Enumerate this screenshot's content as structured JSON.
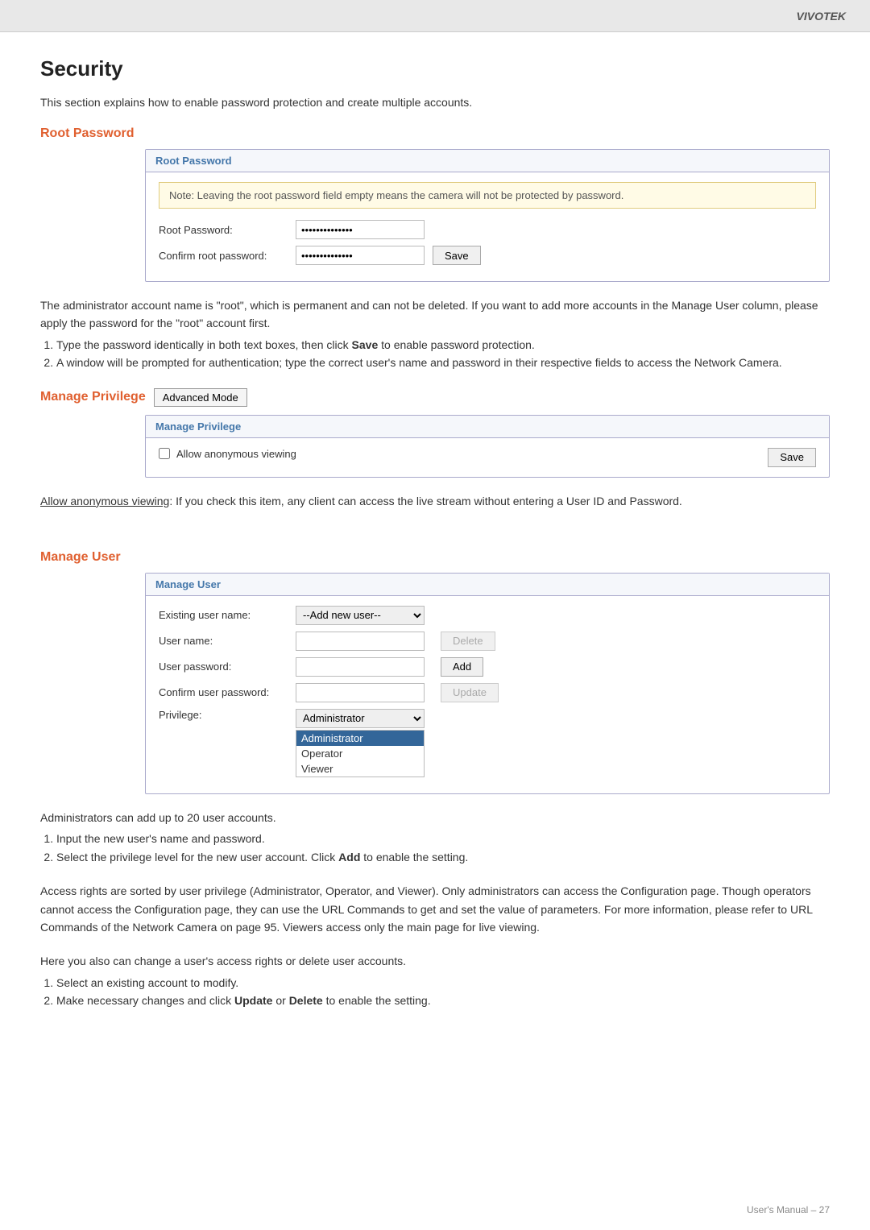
{
  "brand": "VIVOTEK",
  "page": {
    "title": "Security",
    "intro": "This section explains how to enable password protection and create multiple accounts."
  },
  "rootPassword": {
    "sectionTitle": "Root Password",
    "panelTitle": "Root Password",
    "note": "Note: Leaving the root password field empty means the camera will not be protected by password.",
    "fields": [
      {
        "label": "Root Password:",
        "value": "••••••••••••••"
      },
      {
        "label": "Confirm root password:",
        "value": "••••••••••••••"
      }
    ],
    "saveButton": "Save",
    "description": "The administrator account name is \"root\", which is permanent and can not be deleted. If you want to add more accounts in the Manage User column, please apply the password for the \"root\" account first.",
    "steps": [
      "Type the password identically in both text boxes, then click Save to enable password protection.",
      "A window will be prompted for authentication; type the correct user's name and password in their respective fields to access the Network Camera."
    ]
  },
  "managePrivilege": {
    "sectionTitle": "Manage Privilege",
    "advancedModeButton": "Advanced Mode",
    "panelTitle": "Manage Privilege",
    "allowAnonLabel": "Allow anonymous viewing",
    "saveButton": "Save",
    "anonDesc": "Allow anonymous viewing: If you check this item, any client can access the live stream without entering a User ID and Password."
  },
  "manageUser": {
    "sectionTitle": "Manage User",
    "panelTitle": "Manage User",
    "fields": [
      {
        "label": "Existing user name:",
        "type": "select",
        "value": "--Add new user--"
      },
      {
        "label": "User name:",
        "type": "text",
        "value": ""
      },
      {
        "label": "User password:",
        "type": "password",
        "value": ""
      },
      {
        "label": "Confirm user password:",
        "type": "password",
        "value": ""
      },
      {
        "label": "Privilege:",
        "type": "select-with-list",
        "value": "Administrator"
      }
    ],
    "privilegeOptions": [
      "Administrator",
      "Operator",
      "Viewer"
    ],
    "selectedPrivilege": "Administrator",
    "buttons": {
      "delete": "Delete",
      "add": "Add",
      "update": "Update"
    },
    "existingUserOptions": [
      "--Add new user--"
    ],
    "desc1": "Administrators can add up to 20 user accounts.",
    "steps1": [
      "Input the new user's name and password.",
      "Select the privilege level for the new user account. Click Add to enable the setting."
    ],
    "desc2": "Access rights are sorted by user privilege (Administrator, Operator, and Viewer). Only administrators can access the Configuration page. Though operators cannot access the Configuration page, they can use the URL Commands to get and set the value of parameters. For more information, please refer to URL Commands of the Network Camera on page 95. Viewers access only the main page for live viewing.",
    "desc3": "Here you also can change a user's access rights or delete user accounts.",
    "steps2": [
      "Select an existing account to modify.",
      "Make necessary changes and click Update or Delete to enable the setting."
    ]
  },
  "footer": "User's Manual – 27"
}
